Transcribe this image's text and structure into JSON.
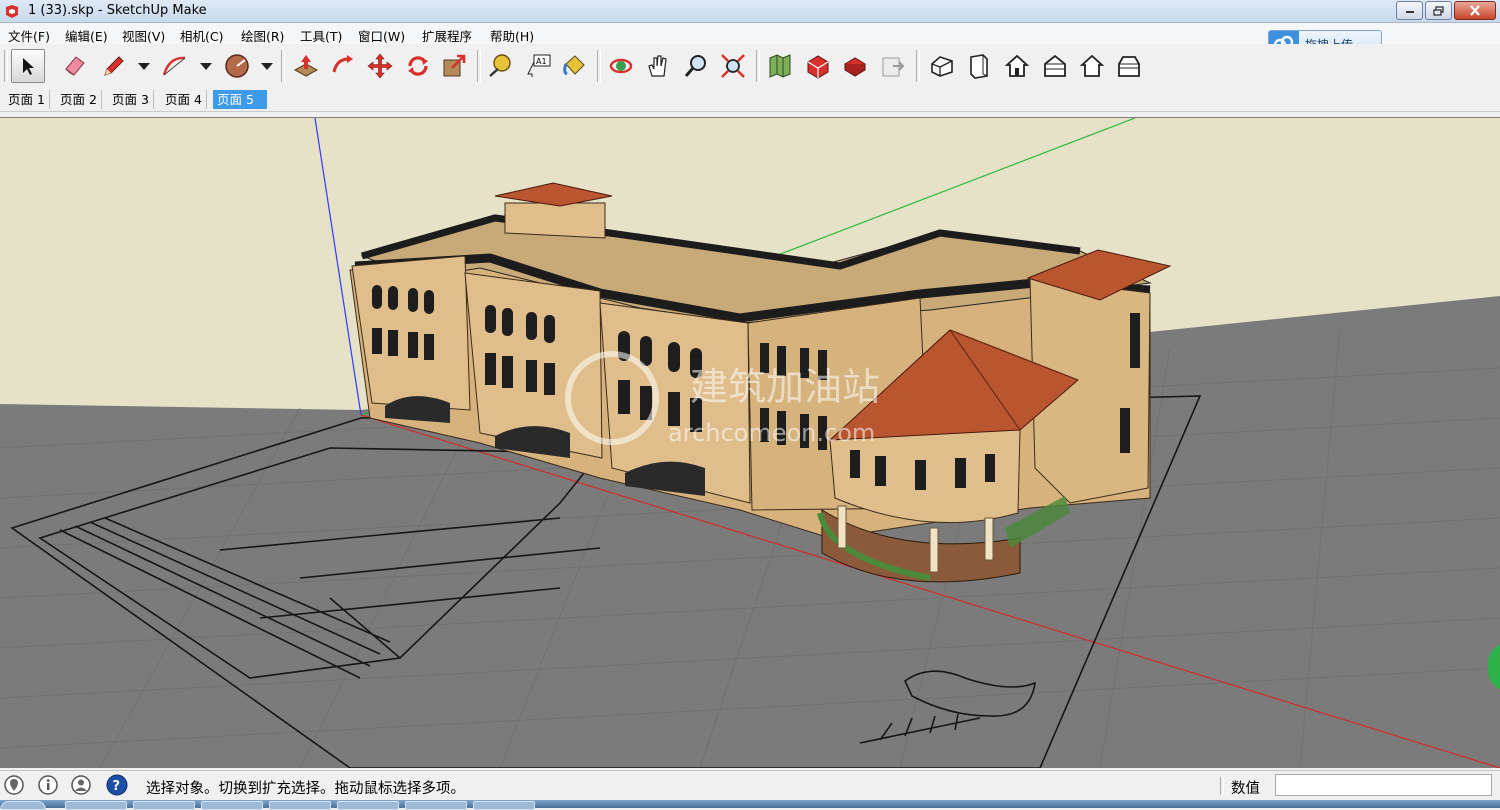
{
  "window": {
    "title": "1 (33).skp - SketchUp Make",
    "minimize": "minimize",
    "maximize": "restore",
    "close": "close"
  },
  "menus": [
    {
      "label": "文件(F)"
    },
    {
      "label": "编辑(E)"
    },
    {
      "label": "视图(V)"
    },
    {
      "label": "相机(C)"
    },
    {
      "label": "绘图(R)"
    },
    {
      "label": "工具(T)"
    },
    {
      "label": "窗口(W)"
    },
    {
      "label": "扩展程序"
    },
    {
      "label": "帮助(H)"
    }
  ],
  "toolbar": {
    "upload_label": "拖拽上传",
    "tools": [
      "select-tool",
      "eraser-tool",
      "pencil-tool",
      "arc-tool",
      "shapes-tool",
      "push-pull-tool",
      "follow-me-tool",
      "move-tool",
      "rotate-tool",
      "scale-tool",
      "tape-measure-tool",
      "text-tool",
      "paint-bucket-tool",
      "orbit-tool",
      "pan-tool",
      "zoom-tool",
      "zoom-extents-tool",
      "previous-view-tool",
      "3d-warehouse-tool",
      "extension-warehouse-tool",
      "layout-tool",
      "iso-view",
      "front-view",
      "top-view",
      "right-view",
      "back-view",
      "left-view"
    ]
  },
  "tabs": [
    {
      "label": "页面 1"
    },
    {
      "label": "页面 2"
    },
    {
      "label": "页面 3"
    },
    {
      "label": "页面 4"
    },
    {
      "label": "页面 5",
      "active": true
    }
  ],
  "watermark": {
    "text_cn": "建筑加油站",
    "text_en": "archcomeon.com"
  },
  "status": {
    "message": "选择对象。切换到扩充选择。拖动鼠标选择多项。",
    "value_label": "数值",
    "value": ""
  },
  "colors": {
    "sky": "#e6e2c8",
    "ground": "#7b7b7b",
    "wall": "#dcb883",
    "roof_tile": "#b9562f",
    "accent_blue": "#3d9be9"
  }
}
